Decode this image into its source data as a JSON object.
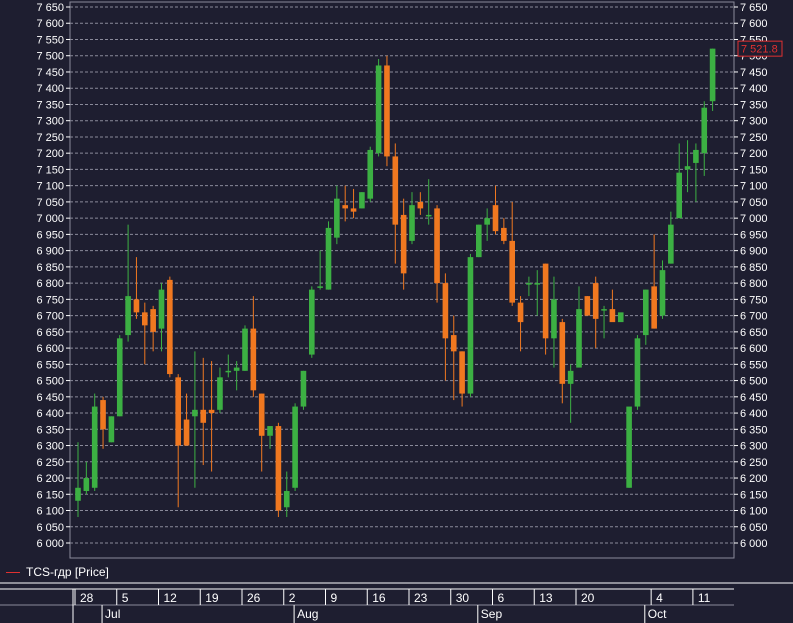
{
  "chart_data": {
    "type": "candlestick",
    "instrument": "TCS-гдр [Price]",
    "colors": {
      "background": "#1e1e30",
      "up": "#3cb043",
      "down": "#f07820",
      "grid": "#8a8a9a",
      "last_price_box": "#e03030"
    },
    "yaxis": {
      "min": 6000,
      "max": 7650,
      "step": 50,
      "ticks": [
        "6 000",
        "6 050",
        "6 100",
        "6 150",
        "6 200",
        "6 250",
        "6 300",
        "6 350",
        "6 400",
        "6 450",
        "6 500",
        "6 550",
        "6 600",
        "6 650",
        "6 700",
        "6 750",
        "6 800",
        "6 850",
        "6 900",
        "6 950",
        "7 000",
        "7 050",
        "7 100",
        "7 150",
        "7 200",
        "7 250",
        "7 300",
        "7 350",
        "7 400",
        "7 450",
        "7 500",
        "7 550",
        "7 600",
        "7 650"
      ],
      "position": "both"
    },
    "last_price": "7 521.8",
    "x_day_labels": [
      {
        "label": "28",
        "index": 0
      },
      {
        "label": "5",
        "index": 5
      },
      {
        "label": "12",
        "index": 10
      },
      {
        "label": "19",
        "index": 15
      },
      {
        "label": "26",
        "index": 20
      },
      {
        "label": "2",
        "index": 25
      },
      {
        "label": "9",
        "index": 30
      },
      {
        "label": "16",
        "index": 35
      },
      {
        "label": "23",
        "index": 40
      },
      {
        "label": "30",
        "index": 45
      },
      {
        "label": "6",
        "index": 50
      },
      {
        "label": "13",
        "index": 55
      },
      {
        "label": "20",
        "index": 60
      },
      {
        "label": "4",
        "index": 69
      },
      {
        "label": "11",
        "index": 74
      }
    ],
    "x_month_labels": [
      {
        "label": "Jul",
        "index": 3
      },
      {
        "label": "Aug",
        "index": 26
      },
      {
        "label": "Sep",
        "index": 48
      },
      {
        "label": "Oct",
        "index": 68
      }
    ],
    "candles": [
      {
        "o": 6130,
        "h": 6310,
        "l": 6080,
        "c": 6170
      },
      {
        "o": 6160,
        "h": 6250,
        "l": 6150,
        "c": 6200
      },
      {
        "o": 6170,
        "h": 6460,
        "l": 6160,
        "c": 6420
      },
      {
        "o": 6440,
        "h": 6450,
        "l": 6290,
        "c": 6350
      },
      {
        "o": 6310,
        "h": 6390,
        "l": 6310,
        "c": 6390
      },
      {
        "o": 6390,
        "h": 6640,
        "l": 6390,
        "c": 6630
      },
      {
        "o": 6640,
        "h": 6980,
        "l": 6620,
        "c": 6760
      },
      {
        "o": 6750,
        "h": 6880,
        "l": 6690,
        "c": 6710
      },
      {
        "o": 6710,
        "h": 6740,
        "l": 6550,
        "c": 6670
      },
      {
        "o": 6720,
        "h": 6730,
        "l": 6590,
        "c": 6650
      },
      {
        "o": 6660,
        "h": 6800,
        "l": 6590,
        "c": 6780
      },
      {
        "o": 6810,
        "h": 6820,
        "l": 6510,
        "c": 6520
      },
      {
        "o": 6510,
        "h": 6520,
        "l": 6110,
        "c": 6300
      },
      {
        "o": 6380,
        "h": 6460,
        "l": 6300,
        "c": 6300
      },
      {
        "o": 6390,
        "h": 6590,
        "l": 6170,
        "c": 6410
      },
      {
        "o": 6410,
        "h": 6570,
        "l": 6240,
        "c": 6370
      },
      {
        "o": 6410,
        "h": 6560,
        "l": 6220,
        "c": 6400
      },
      {
        "o": 6410,
        "h": 6540,
        "l": 6400,
        "c": 6510
      },
      {
        "o": 6530,
        "h": 6580,
        "l": 6510,
        "c": 6530
      },
      {
        "o": 6530,
        "h": 6560,
        "l": 6470,
        "c": 6540
      },
      {
        "o": 6530,
        "h": 6670,
        "l": 6530,
        "c": 6660
      },
      {
        "o": 6660,
        "h": 6760,
        "l": 6450,
        "c": 6470
      },
      {
        "o": 6460,
        "h": 6460,
        "l": 6220,
        "c": 6330
      },
      {
        "o": 6330,
        "h": 6330,
        "l": 6290,
        "c": 6360
      },
      {
        "o": 6360,
        "h": 6370,
        "l": 6080,
        "c": 6100
      },
      {
        "o": 6110,
        "h": 6220,
        "l": 6080,
        "c": 6160
      },
      {
        "o": 6170,
        "h": 6430,
        "l": 6160,
        "c": 6420
      },
      {
        "o": 6420,
        "h": 6530,
        "l": 6410,
        "c": 6530
      },
      {
        "o": 6580,
        "h": 6790,
        "l": 6570,
        "c": 6780
      },
      {
        "o": 6790,
        "h": 6900,
        "l": 6780,
        "c": 6790
      },
      {
        "o": 6780,
        "h": 6990,
        "l": 6780,
        "c": 6970
      },
      {
        "o": 6940,
        "h": 7100,
        "l": 6920,
        "c": 7060
      },
      {
        "o": 7040,
        "h": 7100,
        "l": 6990,
        "c": 7030
      },
      {
        "o": 7030,
        "h": 7090,
        "l": 7000,
        "c": 7020
      },
      {
        "o": 7030,
        "h": 7080,
        "l": 7030,
        "c": 7080
      },
      {
        "o": 7060,
        "h": 7220,
        "l": 7050,
        "c": 7210
      },
      {
        "o": 7200,
        "h": 7490,
        "l": 7190,
        "c": 7470
      },
      {
        "o": 7470,
        "h": 7500,
        "l": 7160,
        "c": 7190
      },
      {
        "o": 7190,
        "h": 7230,
        "l": 6860,
        "c": 6980
      },
      {
        "o": 7010,
        "h": 7060,
        "l": 6780,
        "c": 6830
      },
      {
        "o": 6930,
        "h": 7080,
        "l": 6920,
        "c": 7040
      },
      {
        "o": 7050,
        "h": 7080,
        "l": 7010,
        "c": 7030
      },
      {
        "o": 7010,
        "h": 7120,
        "l": 6980,
        "c": 7010
      },
      {
        "o": 7030,
        "h": 7040,
        "l": 6740,
        "c": 6800
      },
      {
        "o": 6800,
        "h": 6830,
        "l": 6500,
        "c": 6630
      },
      {
        "o": 6640,
        "h": 6700,
        "l": 6440,
        "c": 6590
      },
      {
        "o": 6590,
        "h": 6590,
        "l": 6420,
        "c": 6460
      },
      {
        "o": 6460,
        "h": 6890,
        "l": 6450,
        "c": 6880
      },
      {
        "o": 6880,
        "h": 6980,
        "l": 6880,
        "c": 6980
      },
      {
        "o": 6980,
        "h": 7030,
        "l": 6930,
        "c": 7000
      },
      {
        "o": 7040,
        "h": 7100,
        "l": 6950,
        "c": 6960
      },
      {
        "o": 6970,
        "h": 7000,
        "l": 6920,
        "c": 6930
      },
      {
        "o": 6930,
        "h": 7050,
        "l": 6730,
        "c": 6740
      },
      {
        "o": 6740,
        "h": 6760,
        "l": 6590,
        "c": 6680
      },
      {
        "o": 6800,
        "h": 6820,
        "l": 6760,
        "c": 6800
      },
      {
        "o": 6800,
        "h": 6840,
        "l": 6700,
        "c": 6800
      },
      {
        "o": 6860,
        "h": 6860,
        "l": 6580,
        "c": 6630
      },
      {
        "o": 6630,
        "h": 6820,
        "l": 6540,
        "c": 6750
      },
      {
        "o": 6680,
        "h": 6690,
        "l": 6430,
        "c": 6490
      },
      {
        "o": 6490,
        "h": 6550,
        "l": 6370,
        "c": 6530
      },
      {
        "o": 6540,
        "h": 6790,
        "l": 6550,
        "c": 6720
      },
      {
        "o": 6760,
        "h": 6760,
        "l": 6710,
        "c": 6700
      },
      {
        "o": 6800,
        "h": 6820,
        "l": 6600,
        "c": 6690
      },
      {
        "o": 6720,
        "h": 6730,
        "l": 6630,
        "c": 6720
      },
      {
        "o": 6720,
        "h": 6780,
        "l": 6690,
        "c": 6680
      },
      {
        "o": 6680,
        "h": 6700,
        "l": 6690,
        "c": 6710
      },
      {
        "o": 6170,
        "h": 6370,
        "l": 6170,
        "c": 6420
      },
      {
        "o": 6420,
        "h": 6640,
        "l": 6410,
        "c": 6630
      },
      {
        "o": 6640,
        "h": 6780,
        "l": 6610,
        "c": 6780
      },
      {
        "o": 6790,
        "h": 6950,
        "l": 6660,
        "c": 6660
      },
      {
        "o": 6700,
        "h": 6870,
        "l": 6690,
        "c": 6840
      },
      {
        "o": 6860,
        "h": 7020,
        "l": 6860,
        "c": 6980
      },
      {
        "o": 7000,
        "h": 7230,
        "l": 7000,
        "c": 7140
      },
      {
        "o": 7150,
        "h": 7240,
        "l": 7080,
        "c": 7160
      },
      {
        "o": 7170,
        "h": 7230,
        "l": 7050,
        "c": 7210
      },
      {
        "o": 7200,
        "h": 7360,
        "l": 7130,
        "c": 7340
      },
      {
        "o": 7360,
        "h": 7521.8,
        "l": 7330,
        "c": 7521.8
      }
    ]
  }
}
